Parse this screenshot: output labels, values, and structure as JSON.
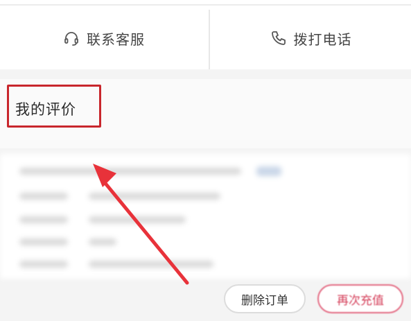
{
  "actions": {
    "customer_service": "联系客服",
    "call_phone": "拨打电话"
  },
  "review": {
    "title": "我的评价"
  },
  "order_buttons": {
    "delete": "删除订单",
    "buy_again": "再次充值"
  },
  "colors": {
    "highlight_border": "#c8262c",
    "arrow": "#e8323a",
    "accent": "#d43d58"
  },
  "icons": {
    "customer_service": "headset-icon",
    "call_phone": "phone-icon"
  }
}
